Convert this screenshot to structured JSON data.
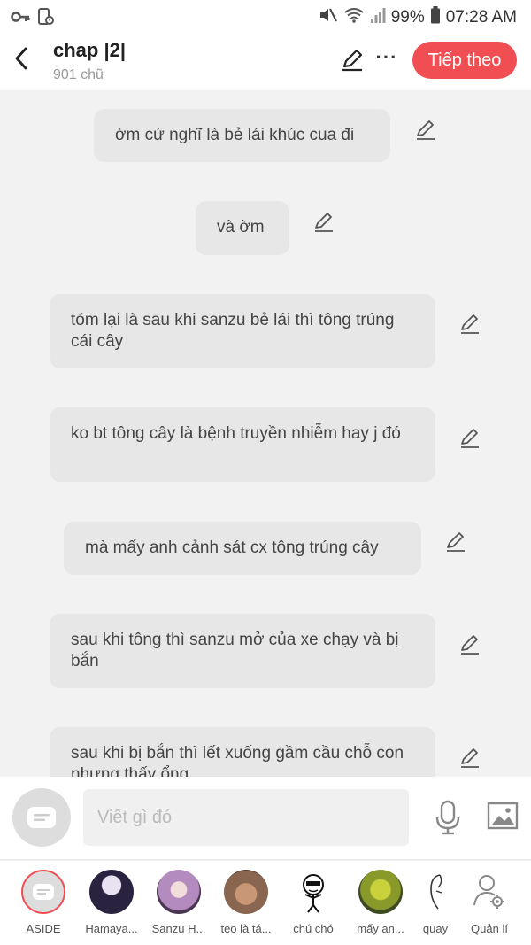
{
  "status": {
    "battery": "99%",
    "time": "07:28 AM"
  },
  "header": {
    "title": "chap |2|",
    "subtitle": "901 chữ",
    "next_label": "Tiếp theo"
  },
  "messages": [
    {
      "text": "ờm cứ nghĩ là bẻ lái khúc cua đi"
    },
    {
      "text": "và ờm"
    },
    {
      "text": "tóm lại là sau khi sanzu bẻ lái thì tông trúng cái cây"
    },
    {
      "text": "ko bt tông cây là bệnh truyền nhiễm hay j đó"
    },
    {
      "text": "mà mấy anh cảnh sát cx tông trúng cây"
    },
    {
      "text": "sau khi tông thì sanzu mở của xe chạy và bị bắn"
    },
    {
      "text": "sau khi bị bắn thì lết xuống gầm cầu chỗ con nhưng thấy ổng"
    }
  ],
  "composer": {
    "placeholder": "Viết gì đó"
  },
  "characters": [
    {
      "name": "ASIDE"
    },
    {
      "name": "Hamaya..."
    },
    {
      "name": "Sanzu H..."
    },
    {
      "name": "teo là tá..."
    },
    {
      "name": "chú chó"
    },
    {
      "name": "mấy an..."
    },
    {
      "name": "quay"
    },
    {
      "name": "Quản lí"
    }
  ],
  "colors": {
    "accent": "#f04e52",
    "bubble": "#e7e7e7",
    "background": "#f2f2f2"
  }
}
